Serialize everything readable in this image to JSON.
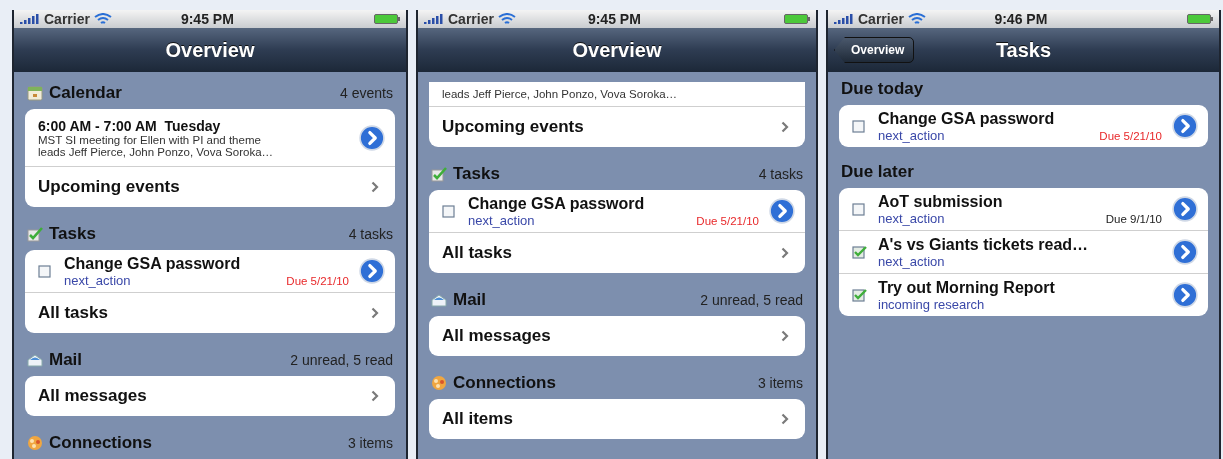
{
  "phones": [
    {
      "status": {
        "carrier": "Carrier",
        "time": "9:45 PM"
      },
      "nav": {
        "title": "Overview"
      },
      "sections": [
        {
          "kind": "calendar",
          "title": "Calendar",
          "count": "4 events",
          "rows": [
            {
              "kind": "event",
              "time": "6:00 AM - 7:00 AM  Tuesday",
              "lines": [
                "MST SI meeting for Ellen with PI and theme",
                "leads Jeff Pierce, John Ponzo, Vova Soroka…"
              ]
            },
            {
              "kind": "link",
              "label": "Upcoming events"
            }
          ]
        },
        {
          "kind": "tasks",
          "title": "Tasks",
          "count": "4 tasks",
          "rows": [
            {
              "kind": "task",
              "title": "Change GSA password",
              "list": "next_action",
              "due": "Due 5/21/10",
              "overdue": true,
              "checked": false
            },
            {
              "kind": "link",
              "label": "All tasks"
            }
          ]
        },
        {
          "kind": "mail",
          "title": "Mail",
          "count": "2 unread, 5 read",
          "rows": [
            {
              "kind": "link",
              "label": "All messages"
            }
          ]
        },
        {
          "kind": "connections",
          "title": "Connections",
          "count": "3 items"
        }
      ]
    },
    {
      "status": {
        "carrier": "Carrier",
        "time": "9:45 PM"
      },
      "nav": {
        "title": "Overview"
      },
      "sections": [
        {
          "rows": [
            {
              "kind": "event_tail",
              "lines": [
                "leads Jeff Pierce, John Ponzo, Vova Soroka…"
              ]
            },
            {
              "kind": "link",
              "label": "Upcoming events"
            }
          ]
        },
        {
          "kind": "tasks",
          "title": "Tasks",
          "count": "4 tasks",
          "rows": [
            {
              "kind": "task",
              "title": "Change GSA password",
              "list": "next_action",
              "due": "Due 5/21/10",
              "overdue": true,
              "checked": false
            },
            {
              "kind": "link",
              "label": "All tasks"
            }
          ]
        },
        {
          "kind": "mail",
          "title": "Mail",
          "count": "2 unread, 5 read",
          "rows": [
            {
              "kind": "link",
              "label": "All messages"
            }
          ]
        },
        {
          "kind": "connections",
          "title": "Connections",
          "count": "3 items",
          "rows": [
            {
              "kind": "link",
              "label": "All items"
            }
          ]
        }
      ]
    },
    {
      "status": {
        "carrier": "Carrier",
        "time": "9:46 PM"
      },
      "nav": {
        "title": "Tasks",
        "back": "Overview"
      },
      "sections": [
        {
          "title": "Due today",
          "rows": [
            {
              "kind": "task",
              "title": "Change GSA password",
              "list": "next_action",
              "due": "Due 5/21/10",
              "overdue": true,
              "checked": false
            }
          ]
        },
        {
          "title": "Due later",
          "rows": [
            {
              "kind": "task",
              "title": "AoT submission",
              "list": "next_action",
              "due": "Due 9/1/10",
              "overdue": false,
              "checked": false
            },
            {
              "kind": "task",
              "title": "A's vs Giants tickets read…",
              "list": "next_action",
              "checked": true
            },
            {
              "kind": "task",
              "title": "Try out Morning Report",
              "list": "incoming research",
              "checked": true
            }
          ]
        }
      ]
    }
  ]
}
